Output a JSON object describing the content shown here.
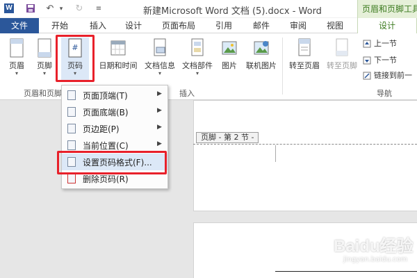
{
  "titlebar": {
    "app_icon": "W",
    "title": "新建Microsoft Word 文档 (5).docx - Word",
    "context_tab_title": "页眉和页脚工具"
  },
  "tabs": {
    "file": "文件",
    "items": [
      "开始",
      "插入",
      "设计",
      "页面布局",
      "引用",
      "邮件",
      "审阅",
      "视图"
    ],
    "active": "设计"
  },
  "ribbon": {
    "buttons": {
      "header": "页眉",
      "footer": "页脚",
      "page_number": "页码",
      "date_time": "日期和时间",
      "doc_info": "文档信息",
      "doc_parts": "文档部件",
      "picture": "图片",
      "online_picture": "联机图片",
      "goto_header": "转至页眉",
      "goto_footer": "转至页脚"
    },
    "nav": {
      "prev": "上一节",
      "next": "下一节",
      "link_prev": "链接到前一"
    },
    "groups": {
      "header_footer": "页眉和页脚",
      "insert": "插入",
      "navigation": "导航"
    }
  },
  "menu": {
    "items": [
      {
        "label": "页面顶端(T)",
        "has_submenu": true
      },
      {
        "label": "页面底端(B)",
        "has_submenu": true
      },
      {
        "label": "页边距(P)",
        "has_submenu": true
      },
      {
        "label": "当前位置(C)",
        "has_submenu": true
      },
      {
        "label": "设置页码格式(F)...",
        "has_submenu": false
      },
      {
        "label": "删除页码(R)",
        "has_submenu": false
      }
    ]
  },
  "document": {
    "footer_tag": "页脚 - 第 2 节 -"
  },
  "watermark": {
    "brand": "Baidu经验",
    "url": "jingyan.baidu.com"
  },
  "colors": {
    "word_blue": "#2b579a",
    "context_green": "#3b7a1e",
    "highlight_red": "#e8202a"
  }
}
